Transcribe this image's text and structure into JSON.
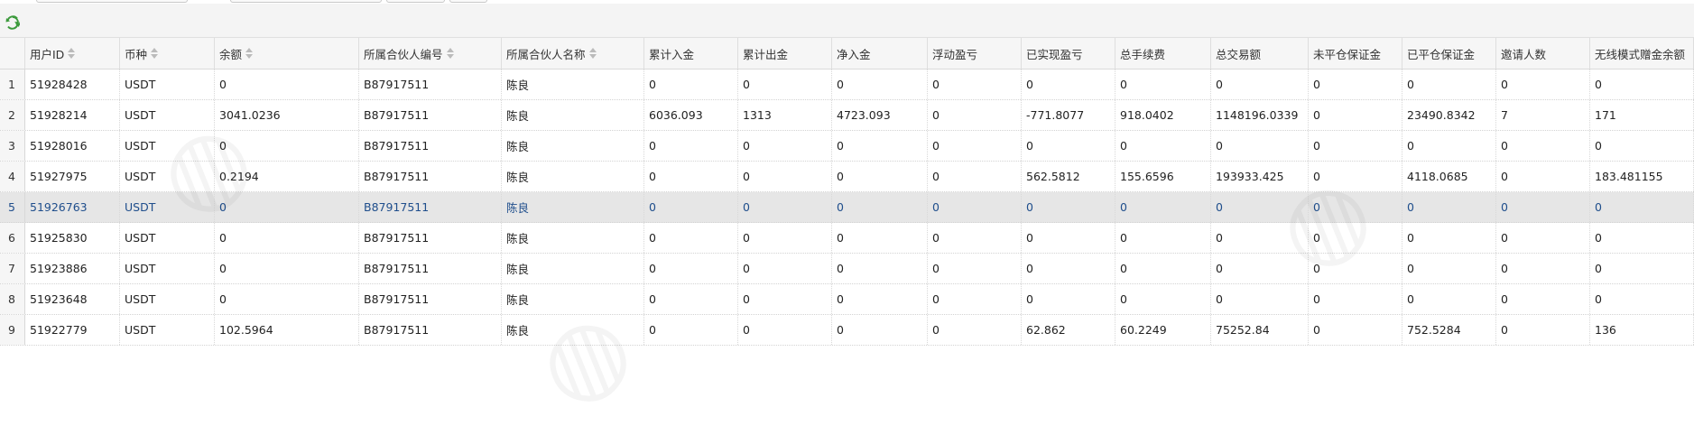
{
  "table": {
    "columns": [
      {
        "label": "用户ID",
        "sortable": true
      },
      {
        "label": "币种",
        "sortable": true
      },
      {
        "label": "余额",
        "sortable": true
      },
      {
        "label": "所属合伙人编号",
        "sortable": true
      },
      {
        "label": "所属合伙人名称",
        "sortable": true
      },
      {
        "label": "累计入金",
        "sortable": false
      },
      {
        "label": "累计出金",
        "sortable": false
      },
      {
        "label": "净入金",
        "sortable": false
      },
      {
        "label": "浮动盈亏",
        "sortable": false
      },
      {
        "label": "已实现盈亏",
        "sortable": false
      },
      {
        "label": "总手续费",
        "sortable": false
      },
      {
        "label": "总交易额",
        "sortable": false
      },
      {
        "label": "未平仓保证金",
        "sortable": false
      },
      {
        "label": "已平仓保证金",
        "sortable": false
      },
      {
        "label": "邀请人数",
        "sortable": false
      },
      {
        "label": "无线模式赠金余额",
        "sortable": false
      }
    ],
    "selected_row": 4,
    "rows": [
      {
        "num": "1",
        "cells": [
          "51928428",
          "USDT",
          "0",
          "B87917511",
          "陈良",
          "0",
          "0",
          "0",
          "0",
          "0",
          "0",
          "0",
          "0",
          "0",
          "0",
          "0"
        ]
      },
      {
        "num": "2",
        "cells": [
          "51928214",
          "USDT",
          "3041.0236",
          "B87917511",
          "陈良",
          "6036.093",
          "1313",
          "4723.093",
          "0",
          "-771.8077",
          "918.0402",
          "1148196.0339",
          "0",
          "23490.8342",
          "7",
          "171"
        ]
      },
      {
        "num": "3",
        "cells": [
          "51928016",
          "USDT",
          "0",
          "B87917511",
          "陈良",
          "0",
          "0",
          "0",
          "0",
          "0",
          "0",
          "0",
          "0",
          "0",
          "0",
          "0"
        ]
      },
      {
        "num": "4",
        "cells": [
          "51927975",
          "USDT",
          "0.2194",
          "B87917511",
          "陈良",
          "0",
          "0",
          "0",
          "0",
          "562.5812",
          "155.6596",
          "193933.425",
          "0",
          "4118.0685",
          "0",
          "183.481155"
        ]
      },
      {
        "num": "5",
        "cells": [
          "51926763",
          "USDT",
          "0",
          "B87917511",
          "陈良",
          "0",
          "0",
          "0",
          "0",
          "0",
          "0",
          "0",
          "0",
          "0",
          "0",
          "0"
        ]
      },
      {
        "num": "6",
        "cells": [
          "51925830",
          "USDT",
          "0",
          "B87917511",
          "陈良",
          "0",
          "0",
          "0",
          "0",
          "0",
          "0",
          "0",
          "0",
          "0",
          "0",
          "0"
        ]
      },
      {
        "num": "7",
        "cells": [
          "51923886",
          "USDT",
          "0",
          "B87917511",
          "陈良",
          "0",
          "0",
          "0",
          "0",
          "0",
          "0",
          "0",
          "0",
          "0",
          "0",
          "0"
        ]
      },
      {
        "num": "8",
        "cells": [
          "51923648",
          "USDT",
          "0",
          "B87917511",
          "陈良",
          "0",
          "0",
          "0",
          "0",
          "0",
          "0",
          "0",
          "0",
          "0",
          "0",
          "0"
        ]
      },
      {
        "num": "9",
        "cells": [
          "51922779",
          "USDT",
          "102.5964",
          "B87917511",
          "陈良",
          "0",
          "0",
          "0",
          "0",
          "62.862",
          "60.2249",
          "75252.84",
          "0",
          "752.5284",
          "0",
          "136"
        ]
      }
    ]
  },
  "icons": {
    "refresh": "refresh-icon",
    "sort": "sort-icon"
  },
  "colors": {
    "selected_text": "#1f4e8c",
    "selected_bg": "#e6e6e6",
    "refresh_icon": "#3c9a3c"
  }
}
